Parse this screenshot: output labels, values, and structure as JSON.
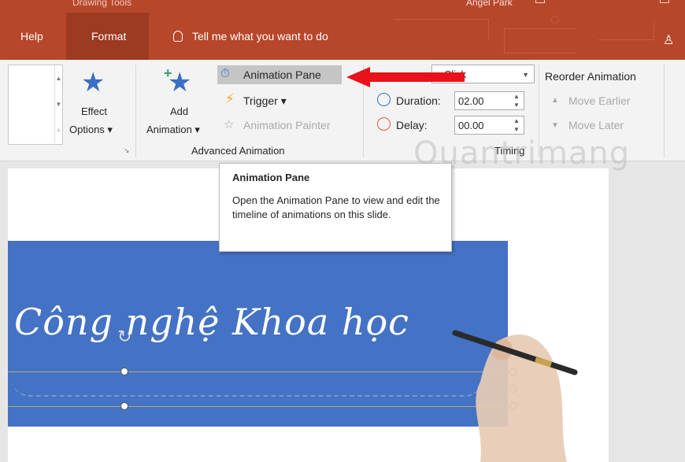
{
  "titlebar": {
    "contextual_group": "Drawing Tools",
    "user": "Angel Park"
  },
  "tabs": [
    {
      "label": "Help"
    },
    {
      "label": "Format"
    }
  ],
  "tell_me": "Tell me what you want to do",
  "ribbon": {
    "effect_options": {
      "line1": "Effect",
      "line2": "Options ▾"
    },
    "add_animation": {
      "line1": "Add",
      "line2": "Animation ▾"
    },
    "animation_pane": "Animation Pane",
    "trigger": "Trigger ▾",
    "animation_painter": "Animation Painter",
    "advanced_group": "Advanced Animation",
    "start_value": "n Click",
    "duration_label": "Duration:",
    "duration_value": "02.00",
    "delay_label": "Delay:",
    "delay_value": "00.00",
    "timing_group": "Timing",
    "reorder_title": "Reorder Animation",
    "move_earlier": "Move Earlier",
    "move_later": "Move Later"
  },
  "tooltip": {
    "title": "Animation Pane",
    "body": "Open the Animation Pane to view and edit the timeline of animations on this slide."
  },
  "slide": {
    "text": "Công nghệ Khoa học"
  },
  "watermark": "Quantrimang",
  "colors": {
    "accent": "#b7472a",
    "slide_bg": "#4472c4",
    "arrow": "#e8131a"
  }
}
